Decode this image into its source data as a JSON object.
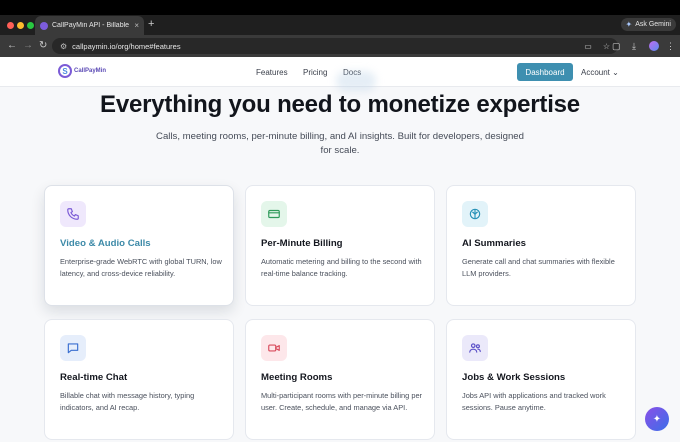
{
  "browser": {
    "tab_title": "CallPayMin API - Billable Calls",
    "tab_close": "×",
    "new_tab": "+",
    "ask_gemini": "Ask Gemini",
    "url": "callpaymin.io/org/home#features"
  },
  "nav": {
    "logo_text": "CallPayMin",
    "logo_mark": "S",
    "links": [
      "Features",
      "Pricing",
      "Docs"
    ],
    "dashboard": "Dashboard",
    "account": "Account"
  },
  "hero": {
    "title": "Everything you need to monetize expertise",
    "subtitle": "Calls, meeting rooms, per-minute billing, and AI insights. Built for developers, designed for scale."
  },
  "features": [
    {
      "title": "Video & Audio Calls",
      "desc": "Enterprise-grade WebRTC with global TURN, low latency, and cross-device reliability.",
      "icon": "phone-icon",
      "color": "#7b5bd6",
      "bg": "#efe8fc"
    },
    {
      "title": "Per-Minute Billing",
      "desc": "Automatic metering and billing to the second with real-time balance tracking.",
      "icon": "credit-card-icon",
      "color": "#2f9a5a",
      "bg": "#e4f6ea"
    },
    {
      "title": "AI Summaries",
      "desc": "Generate call and chat summaries with flexible LLM providers.",
      "icon": "brain-icon",
      "color": "#2a93b8",
      "bg": "#e2f3f9"
    },
    {
      "title": "Real-time Chat",
      "desc": "Billable chat with message history, typing indicators, and AI recap.",
      "icon": "chat-icon",
      "color": "#3a6fd0",
      "bg": "#e6eefb"
    },
    {
      "title": "Meeting Rooms",
      "desc": "Multi-participant rooms with per-minute billing per user. Create, schedule, and manage via API.",
      "icon": "video-icon",
      "color": "#d94d5e",
      "bg": "#fde7ea"
    },
    {
      "title": "Jobs & Work Sessions",
      "desc": "Jobs API with applications and tracked work sessions. Pause anytime.",
      "icon": "users-icon",
      "color": "#5a4fc8",
      "bg": "#ebe9fa"
    }
  ],
  "colors": {
    "accent": "#3e8fb0",
    "title": "#12151c"
  }
}
